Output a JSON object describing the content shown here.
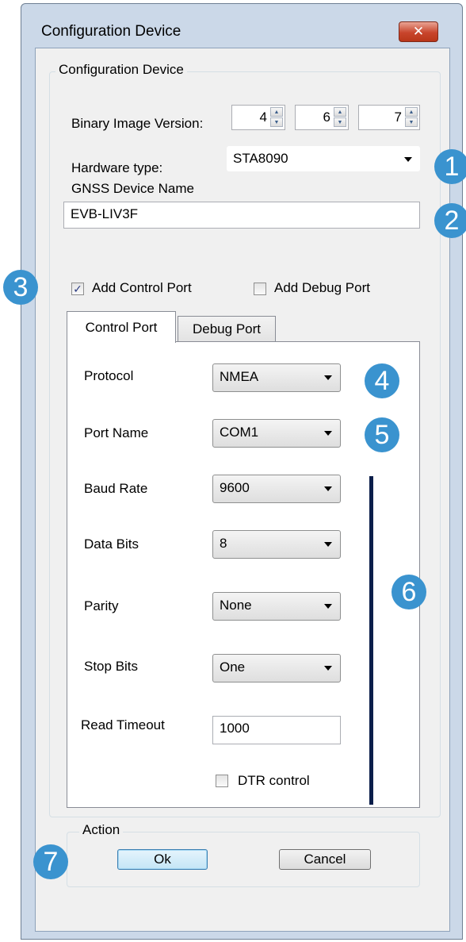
{
  "window": {
    "title": "Configuration Device",
    "close_glyph": "✕"
  },
  "config_group": {
    "legend": "Configuration Device"
  },
  "binary_image": {
    "label": "Binary Image Version:",
    "values": [
      "4",
      "6",
      "7"
    ]
  },
  "hardware": {
    "label": "Hardware type:",
    "value": "STA8090"
  },
  "gnss": {
    "label": "GNSS Device Name",
    "value": "EVB-LIV3F"
  },
  "checkboxes": {
    "control": {
      "label": "Add Control Port",
      "checked": true,
      "mark": "✓"
    },
    "debug": {
      "label": "Add Debug Port",
      "checked": false
    }
  },
  "tabs": [
    {
      "label": "Control Port",
      "active": true
    },
    {
      "label": "Debug Port",
      "active": false
    }
  ],
  "control_port": {
    "protocol": {
      "label": "Protocol",
      "value": "NMEA"
    },
    "port_name": {
      "label": "Port Name",
      "value": "COM1"
    },
    "baud_rate": {
      "label": "Baud Rate",
      "value": "9600"
    },
    "data_bits": {
      "label": "Data Bits",
      "value": "8"
    },
    "parity": {
      "label": "Parity",
      "value": "None"
    },
    "stop_bits": {
      "label": "Stop Bits",
      "value": "One"
    },
    "read_timeout": {
      "label": "Read Timeout",
      "value": "1000"
    },
    "dtr": {
      "label": "DTR control",
      "checked": false
    }
  },
  "action": {
    "legend": "Action",
    "ok": "Ok",
    "cancel": "Cancel"
  },
  "callouts": [
    "1",
    "2",
    "3",
    "4",
    "5",
    "6",
    "7"
  ],
  "colors": {
    "callout": "#3a93cf",
    "bracket": "#0b1e4a",
    "window_frame": "#cbd8e8",
    "dialog_bg": "#f0f0f0"
  }
}
